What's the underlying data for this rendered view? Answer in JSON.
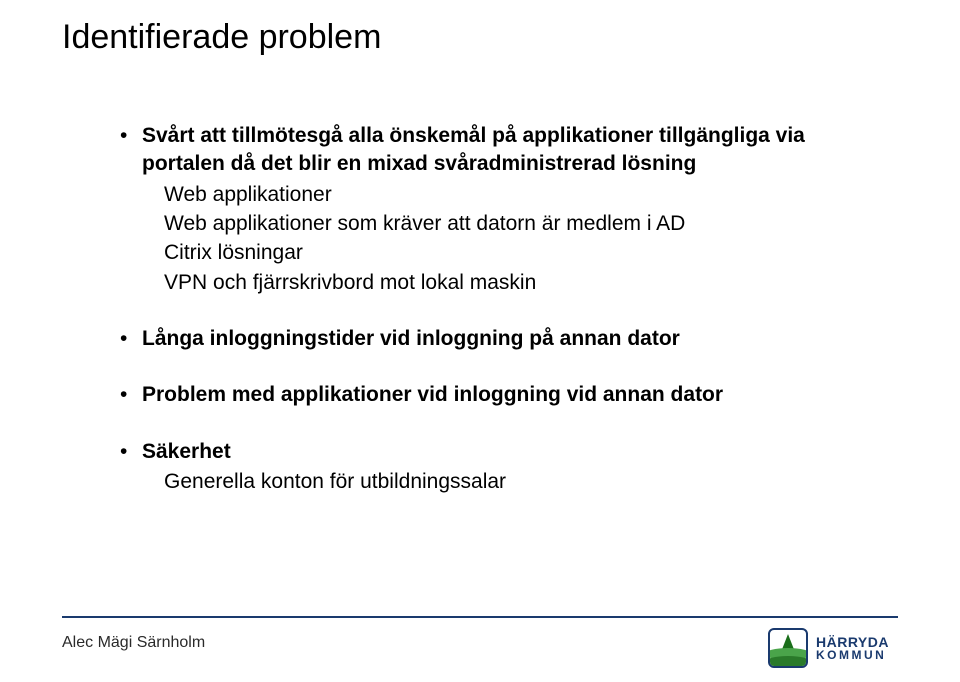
{
  "title": "Identifierade problem",
  "bullets": [
    {
      "bold": "Svårt att tillmötesgå alla önskemål på applikationer tillgängliga via portalen då det blir en mixad svåradministrerad lösning",
      "subs": [
        "Web applikationer",
        "Web applikationer som kräver att datorn är medlem i AD",
        "Citrix lösningar",
        "VPN och fjärrskrivbord mot lokal maskin"
      ]
    },
    {
      "bold": "Långa inloggningstider vid inloggning på annan dator"
    },
    {
      "bold": "Problem med applikationer vid inloggning vid annan dator"
    },
    {
      "bold": "Säkerhet",
      "subs": [
        "Generella konton för utbildningssalar"
      ]
    }
  ],
  "footer": {
    "author": "Alec Mägi Särnholm"
  },
  "logo": {
    "line1": "HÄRRYDA",
    "line2": "KOMMUN"
  }
}
